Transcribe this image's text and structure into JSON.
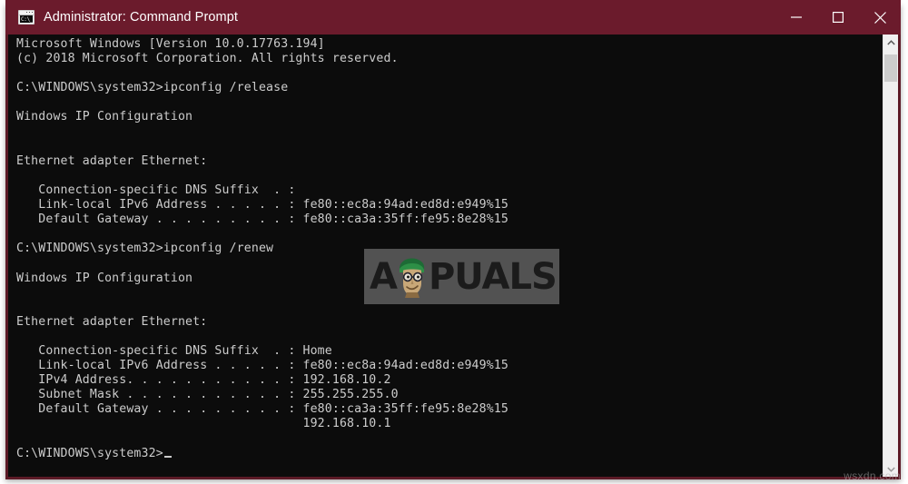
{
  "window": {
    "title": "Administrator: Command Prompt",
    "icon": "command-prompt-icon",
    "icon_glyph": "C:\\_",
    "titlebar_color": "#6b1b2c",
    "console_bg": "#0c0c0c",
    "console_fg": "#cccccc",
    "controls": {
      "minimize_label": "Minimize",
      "maximize_label": "Maximize",
      "close_label": "Close"
    }
  },
  "scrollbar": {
    "up_arrow": "chevron-up-icon",
    "down_arrow": "chevron-down-icon"
  },
  "terminal": {
    "lines": [
      "Microsoft Windows [Version 10.0.17763.194]",
      "(c) 2018 Microsoft Corporation. All rights reserved.",
      "",
      "C:\\WINDOWS\\system32>ipconfig /release",
      "",
      "Windows IP Configuration",
      "",
      "",
      "Ethernet adapter Ethernet:",
      "",
      "   Connection-specific DNS Suffix  . :",
      "   Link-local IPv6 Address . . . . . : fe80::ec8a:94ad:ed8d:e949%15",
      "   Default Gateway . . . . . . . . . : fe80::ca3a:35ff:fe95:8e28%15",
      "",
      "C:\\WINDOWS\\system32>ipconfig /renew",
      "",
      "Windows IP Configuration",
      "",
      "",
      "Ethernet adapter Ethernet:",
      "",
      "   Connection-specific DNS Suffix  . : Home",
      "   Link-local IPv6 Address . . . . . : fe80::ec8a:94ad:ed8d:e949%15",
      "   IPv4 Address. . . . . . . . . . . : 192.168.10.2",
      "   Subnet Mask . . . . . . . . . . . : 255.255.255.0",
      "   Default Gateway . . . . . . . . . : fe80::ca3a:35ff:fe95:8e28%15",
      "                                       192.168.10.1",
      "",
      "C:\\WINDOWS\\system32>"
    ],
    "prompt_cursor": "_"
  },
  "watermark": {
    "prefix": "A",
    "face": "appuals-mascot-icon",
    "suffix": "PUALS"
  },
  "site_watermark": {
    "text": "wsxdn.com"
  }
}
